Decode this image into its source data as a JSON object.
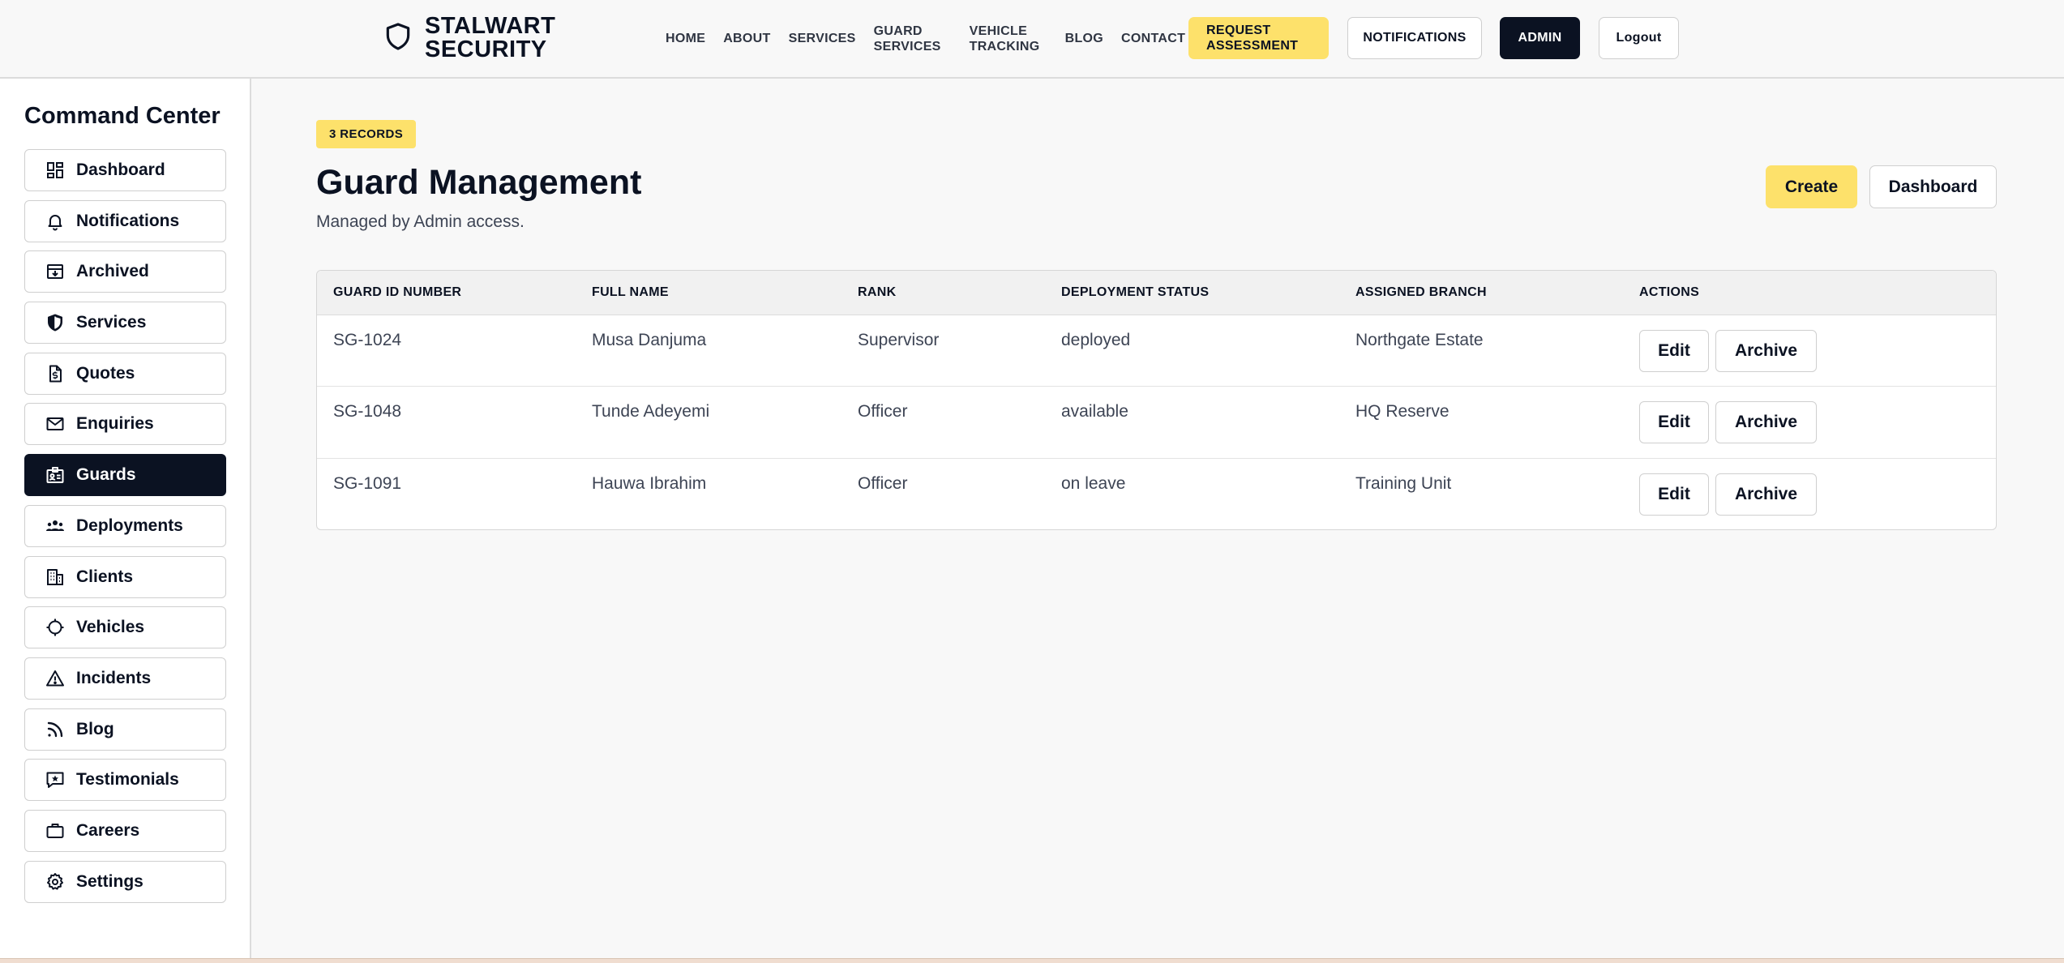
{
  "header": {
    "brand": "STALWART SECURITY",
    "nav": [
      "HOME",
      "ABOUT",
      "SERVICES",
      "GUARD SERVICES",
      "VEHICLE TRACKING",
      "BLOG",
      "CONTACT"
    ],
    "request_label": "REQUEST ASSESSMENT",
    "notifications_label": "NOTIFICATIONS",
    "admin_label": "ADMIN",
    "logout_label": "Logout"
  },
  "sidebar": {
    "title": "Command Center",
    "items": [
      {
        "label": "Dashboard",
        "icon": "dashboard-icon"
      },
      {
        "label": "Notifications",
        "icon": "bell-icon"
      },
      {
        "label": "Archived",
        "icon": "archive-icon"
      },
      {
        "label": "Services",
        "icon": "shield-icon"
      },
      {
        "label": "Quotes",
        "icon": "quote-doc-icon"
      },
      {
        "label": "Enquiries",
        "icon": "mail-icon"
      },
      {
        "label": "Guards",
        "icon": "id-card-icon"
      },
      {
        "label": "Deployments",
        "icon": "users-icon"
      },
      {
        "label": "Clients",
        "icon": "building-icon"
      },
      {
        "label": "Vehicles",
        "icon": "crosshair-icon"
      },
      {
        "label": "Incidents",
        "icon": "warning-icon"
      },
      {
        "label": "Blog",
        "icon": "rss-icon"
      },
      {
        "label": "Testimonials",
        "icon": "message-star-icon"
      },
      {
        "label": "Careers",
        "icon": "briefcase-icon"
      },
      {
        "label": "Settings",
        "icon": "gear-icon"
      }
    ],
    "active": "Guards"
  },
  "main": {
    "badge": "3 RECORDS",
    "title": "Guard Management",
    "subtitle": "Managed by Admin access.",
    "create_label": "Create",
    "dashboard_label": "Dashboard",
    "table": {
      "headers": [
        "GUARD ID NUMBER",
        "FULL NAME",
        "RANK",
        "DEPLOYMENT STATUS",
        "ASSIGNED BRANCH",
        "ACTIONS"
      ],
      "rows": [
        {
          "id": "SG-1024",
          "name": "Musa Danjuma",
          "rank": "Supervisor",
          "status": "deployed",
          "branch": "Northgate Estate"
        },
        {
          "id": "SG-1048",
          "name": "Tunde Adeyemi",
          "rank": "Officer",
          "status": "available",
          "branch": "HQ Reserve"
        },
        {
          "id": "SG-1091",
          "name": "Hauwa Ibrahim",
          "rank": "Officer",
          "status": "on leave",
          "branch": "Training Unit"
        }
      ],
      "edit_label": "Edit",
      "archive_label": "Archive"
    }
  },
  "colors": {
    "accent": "#fde16b",
    "dark": "#0b1222",
    "border": "#cfcfcf",
    "background": "#f8f8f8"
  }
}
